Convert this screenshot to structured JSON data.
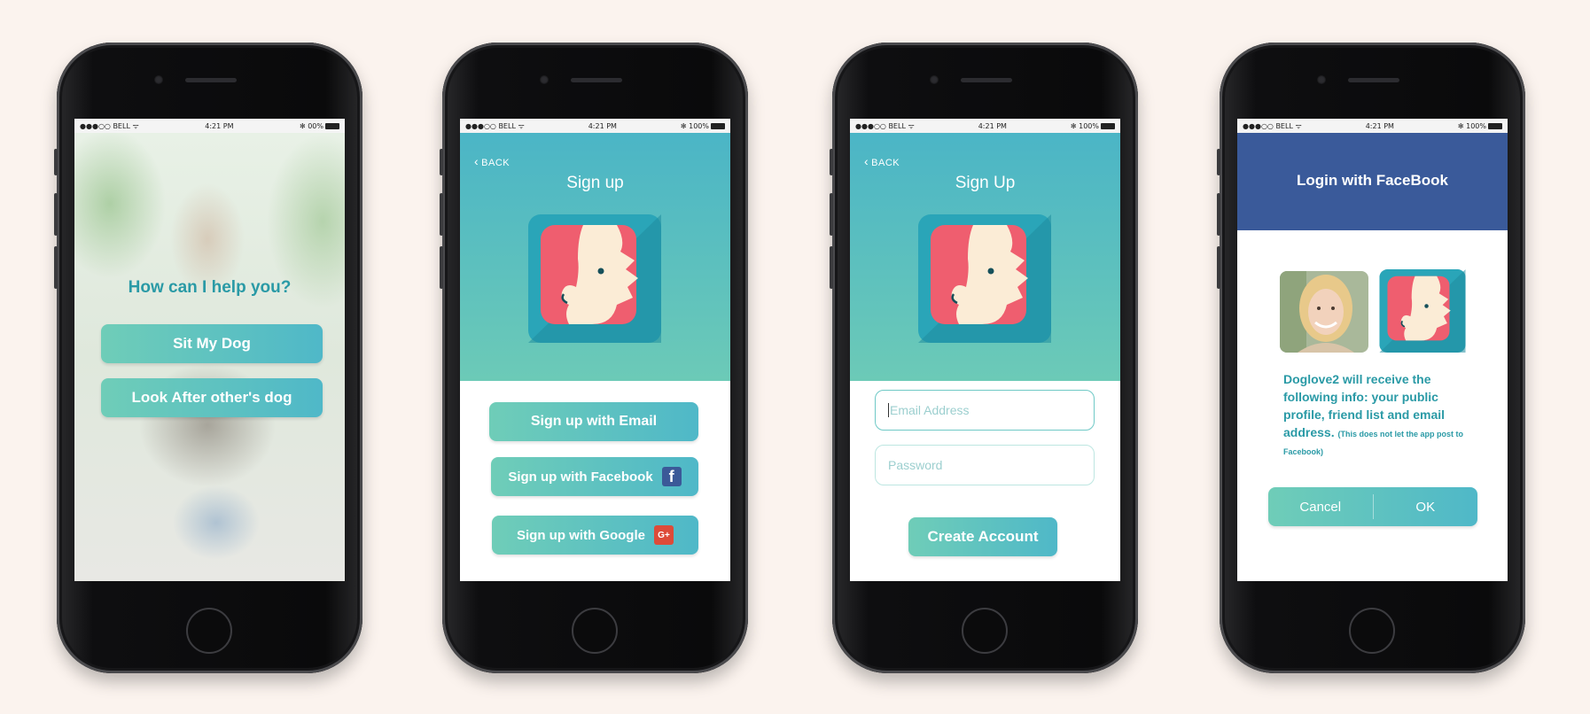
{
  "statusbar": {
    "s1": {
      "carrier": "●●●○○ BELL ᯤ",
      "time": "4:21 PM",
      "battery": "✻ 00%"
    },
    "s2": {
      "carrier": "●●●○○ BELL ᯤ",
      "time": "4:21 PM",
      "battery": "✻ 100%"
    },
    "s3": {
      "carrier": "●●●○○ BELL ᯤ",
      "time": "4:21 PM",
      "battery": "✻ 100%"
    },
    "s4": {
      "carrier": "●●●○○ BELL ᯤ",
      "time": "4:21 PM",
      "battery": "✻ 100%"
    }
  },
  "screen1": {
    "title": "How can I help you?",
    "btn_sit": "Sit My Dog",
    "btn_look": "Look After other's dog"
  },
  "screen2": {
    "back": "BACK",
    "title": "Sign up",
    "btn_email": "Sign up with Email",
    "btn_facebook": "Sign up with Facebook",
    "btn_google": "Sign up with Google",
    "fb_glyph": "f",
    "g_glyph": "G+"
  },
  "screen3": {
    "back": "BACK",
    "title": "Sign Up",
    "email_placeholder": "Email Address",
    "password_placeholder": "Password",
    "btn_create": "Create Account"
  },
  "screen4": {
    "title": "Login with FaceBook",
    "info": "Doglove2 will receive the following info: your public profile, friend list and email address.",
    "info_small": "(This does not let the app post to Facebook)",
    "btn_cancel": "Cancel",
    "btn_ok": "OK"
  },
  "colors": {
    "teal": "#4bb5c6",
    "mint": "#6ccab7",
    "text_teal": "#2a9aa6",
    "facebook_blue": "#3a5a9a",
    "logo_pink": "#ef5e6f",
    "logo_cream": "#fbecd6"
  },
  "icons": [
    "chevron-left-icon",
    "facebook-icon",
    "google-plus-icon",
    "dog-logo-icon",
    "wifi-icon",
    "bluetooth-icon",
    "battery-icon"
  ]
}
